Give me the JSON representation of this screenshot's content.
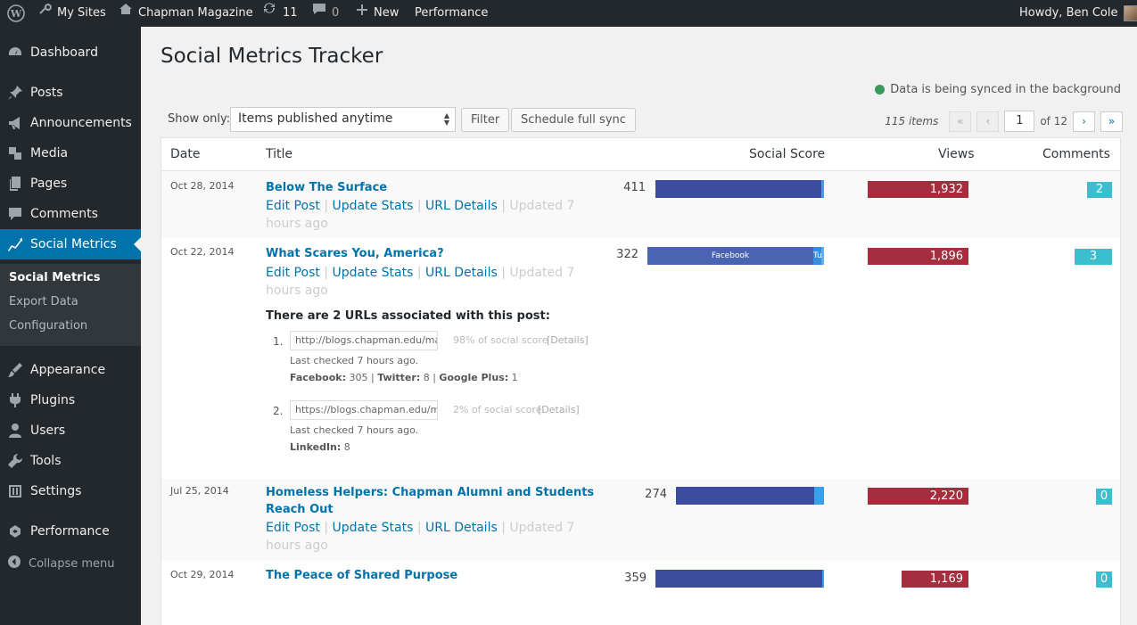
{
  "adminbar": {
    "my_sites": "My Sites",
    "site_name": "Chapman Magazine",
    "updates_count": "11",
    "comments_count": "0",
    "new_label": "New",
    "performance": "Performance",
    "howdy": "Howdy, Ben Cole"
  },
  "sidebar": {
    "items": [
      {
        "label": "Dashboard",
        "icon": "dashboard-icon"
      },
      {
        "label": "Posts",
        "icon": "pin-icon"
      },
      {
        "label": "Announcements",
        "icon": "megaphone-icon"
      },
      {
        "label": "Media",
        "icon": "media-icon"
      },
      {
        "label": "Pages",
        "icon": "pages-icon"
      },
      {
        "label": "Comments",
        "icon": "comment-icon"
      },
      {
        "label": "Social Metrics",
        "icon": "chart-icon"
      },
      {
        "label": "Appearance",
        "icon": "brush-icon"
      },
      {
        "label": "Plugins",
        "icon": "plug-icon"
      },
      {
        "label": "Users",
        "icon": "user-icon"
      },
      {
        "label": "Tools",
        "icon": "wrench-icon"
      },
      {
        "label": "Settings",
        "icon": "settings-icon"
      },
      {
        "label": "Performance",
        "icon": "performance-icon"
      }
    ],
    "submenu": [
      "Social Metrics",
      "Export Data",
      "Configuration"
    ],
    "collapse": "Collapse menu"
  },
  "page": {
    "title": "Social Metrics Tracker",
    "sync_status": "Data is being synced in the background",
    "show_only_label": "Show only:",
    "filter_value": "Items published anytime",
    "filter_button": "Filter",
    "sync_button": "Schedule full sync",
    "items_count": "115 items",
    "first_page": "«",
    "prev_page": "‹",
    "current_page": "1",
    "of_pages": "of 12",
    "next_page": "›",
    "last_page": "»",
    "colors": {
      "accent": "#0073aa",
      "bar": "#3b5998",
      "views": "#a52d3d",
      "comments": "#3bbfcf"
    }
  },
  "table": {
    "headers": {
      "date": "Date",
      "title": "Title",
      "score": "Social Score",
      "views": "Views",
      "comments": "Comments"
    },
    "action_edit": "Edit Post",
    "action_update": "Update Stats",
    "action_url": "URL Details",
    "updated": "Updated 7 hours ago",
    "rows": [
      {
        "date": "Oct 28, 2014",
        "title": "Below The Surface",
        "score": "411",
        "views": "1,932",
        "comments": "2"
      },
      {
        "date": "Oct 22, 2014",
        "title": "What Scares You, America?",
        "score": "322",
        "views": "1,896",
        "comments": "3",
        "bar_label": "Facebook",
        "bar_label2": "Tu"
      },
      {
        "date": "Jul 25, 2014",
        "title": "Homeless Helpers: Chapman Alumni and Students Reach Out",
        "score": "274",
        "views": "2,220",
        "comments": "0"
      },
      {
        "date": "Oct 29, 2014",
        "title": "The Peace of Shared Purpose",
        "score": "359",
        "views": "1,169",
        "comments": "0"
      }
    ],
    "urls": {
      "heading": "There are 2 URLs associated with this post:",
      "items": [
        {
          "num": "1.",
          "url": "http://blogs.chapman.edu/ma",
          "pct": "98% of social score",
          "details": "[Details]",
          "checked": "Last checked 7 hours ago.",
          "stats_label1": "Facebook:",
          "stats_val1": "305",
          "stats_label2": "Twitter:",
          "stats_val2": "8",
          "stats_label3": "Google Plus:",
          "stats_val3": "1"
        },
        {
          "num": "2.",
          "url": "https://blogs.chapman.edu/m",
          "pct": "2% of social score",
          "details": "[Details]",
          "checked": "Last checked 7 hours ago.",
          "stats_label1": "LinkedIn:",
          "stats_val1": "8"
        }
      ]
    }
  }
}
